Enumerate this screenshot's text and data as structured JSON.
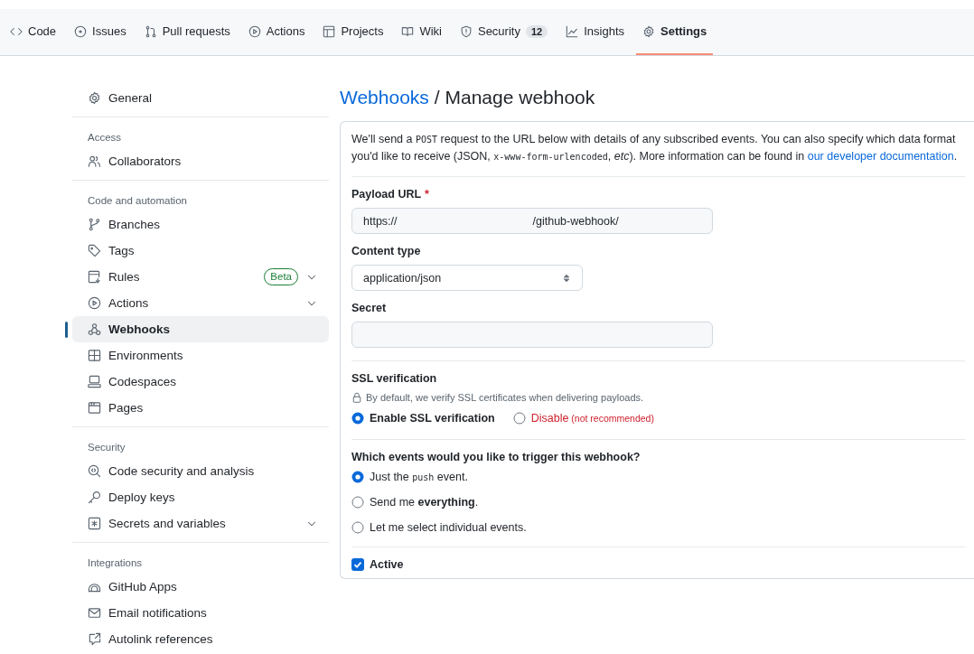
{
  "repo_tabs": [
    {
      "label": "Code",
      "selected": false
    },
    {
      "label": "Issues",
      "selected": false
    },
    {
      "label": "Pull requests",
      "selected": false
    },
    {
      "label": "Actions",
      "selected": false
    },
    {
      "label": "Projects",
      "selected": false
    },
    {
      "label": "Wiki",
      "selected": false
    },
    {
      "label": "Security",
      "selected": false,
      "counter": "12"
    },
    {
      "label": "Insights",
      "selected": false
    },
    {
      "label": "Settings",
      "selected": true
    }
  ],
  "sidebar": {
    "groups": [
      {
        "items": [
          {
            "label": "General",
            "selected": false,
            "expandable": false
          }
        ]
      },
      {
        "heading": "Access",
        "items": [
          {
            "label": "Collaborators",
            "selected": false,
            "expandable": false
          }
        ]
      },
      {
        "heading": "Code and automation",
        "items": [
          {
            "label": "Branches",
            "selected": false,
            "expandable": false
          },
          {
            "label": "Tags",
            "selected": false,
            "expandable": false
          },
          {
            "label": "Rules",
            "selected": false,
            "expandable": true,
            "badge": "Beta"
          },
          {
            "label": "Actions",
            "selected": false,
            "expandable": true
          },
          {
            "label": "Webhooks",
            "selected": true,
            "expandable": false
          },
          {
            "label": "Environments",
            "selected": false,
            "expandable": false
          },
          {
            "label": "Codespaces",
            "selected": false,
            "expandable": false
          },
          {
            "label": "Pages",
            "selected": false,
            "expandable": false
          }
        ]
      },
      {
        "heading": "Security",
        "items": [
          {
            "label": "Code security and analysis",
            "selected": false,
            "expandable": false
          },
          {
            "label": "Deploy keys",
            "selected": false,
            "expandable": false
          },
          {
            "label": "Secrets and variables",
            "selected": false,
            "expandable": true
          }
        ]
      },
      {
        "heading": "Integrations",
        "items": [
          {
            "label": "GitHub Apps",
            "selected": false,
            "expandable": false
          },
          {
            "label": "Email notifications",
            "selected": false,
            "expandable": false
          },
          {
            "label": "Autolink references",
            "selected": false,
            "expandable": false
          }
        ]
      }
    ]
  },
  "page": {
    "breadcrumb_link": "Webhooks",
    "title": "/ Manage webhook",
    "description": [
      {
        "kind": "plain",
        "text": "We'll send a "
      },
      {
        "kind": "code",
        "text": "POST"
      },
      {
        "kind": "plain",
        "text": " request to the URL below with details of any subscribed events. You can also specify which data format you'd like to receive (JSON, "
      },
      {
        "kind": "code",
        "text": "x-www-form-urlencoded"
      },
      {
        "kind": "plain",
        "text": ", "
      },
      {
        "kind": "italic",
        "text": "etc"
      },
      {
        "kind": "plain",
        "text": "). More information can be found in "
      },
      {
        "kind": "link",
        "text": "our developer documentation"
      },
      {
        "kind": "plain",
        "text": "."
      }
    ],
    "payload_url": {
      "label": "Payload URL",
      "required_mark": "*",
      "value_start": "https://",
      "value_end": "/github-webhook/"
    },
    "content_type": {
      "label": "Content type",
      "value": "application/json"
    },
    "secret": {
      "label": "Secret"
    },
    "ssl": {
      "heading": "SSL verification",
      "note": "By default, we verify SSL certificates when delivering payloads.",
      "options": [
        {
          "kind": "normal",
          "label": "Enable SSL verification",
          "selected": true
        },
        {
          "kind": "danger",
          "label": "Disable",
          "note": "(not recommended)",
          "selected": false
        }
      ]
    },
    "events": {
      "question": "Which events would you like to trigger this webhook?",
      "options": [
        {
          "selected": true,
          "parts": [
            {
              "kind": "plain",
              "text": "Just the "
            },
            {
              "kind": "code",
              "text": "push"
            },
            {
              "kind": "plain",
              "text": " event."
            }
          ]
        },
        {
          "selected": false,
          "parts": [
            {
              "kind": "plain",
              "text": "Send me "
            },
            {
              "kind": "bold",
              "text": "everything"
            },
            {
              "kind": "plain",
              "text": "."
            }
          ]
        },
        {
          "selected": false,
          "parts": [
            {
              "kind": "plain",
              "text": "Let me select individual events."
            }
          ]
        }
      ]
    },
    "active": {
      "label": "Active",
      "checked": true
    }
  }
}
